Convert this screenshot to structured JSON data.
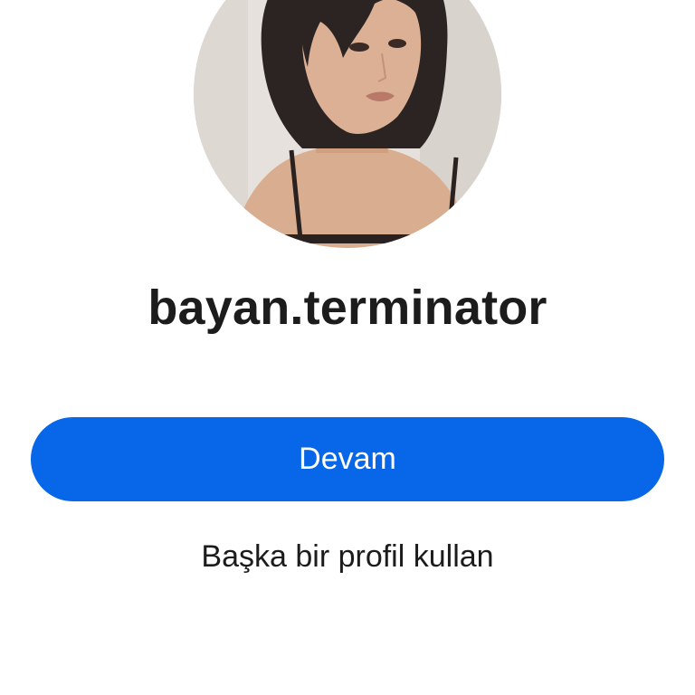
{
  "profile": {
    "username": "bayan.terminator",
    "avatar_icon": "profile-photo"
  },
  "actions": {
    "continue_label": "Devam",
    "switch_profile_label": "Başka bir profil kullan"
  },
  "colors": {
    "primary_button": "#0866e8",
    "button_text": "#ffffff",
    "text": "#1c1c1c",
    "background": "#ffffff"
  }
}
